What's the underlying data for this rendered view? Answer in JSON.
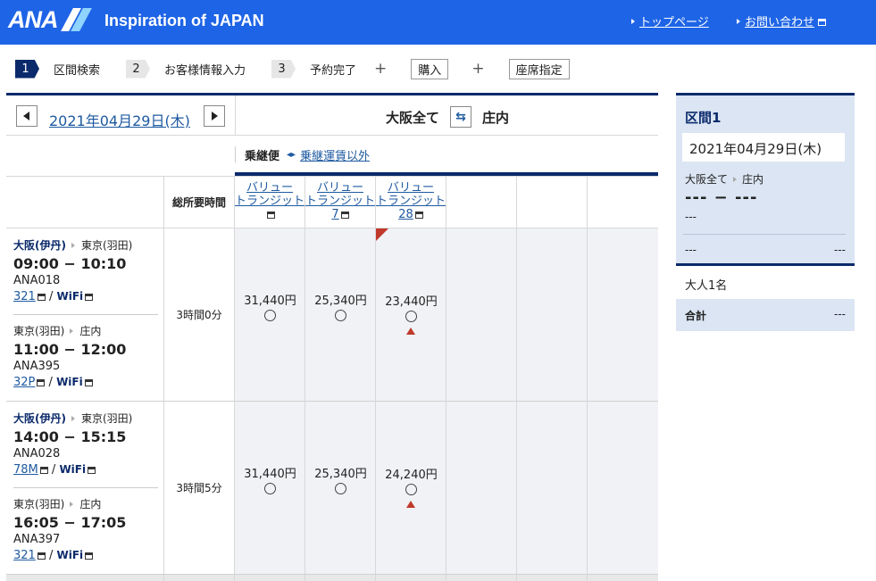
{
  "header": {
    "logo": "ANA",
    "tagline": "Inspiration of JAPAN",
    "links": [
      "トップページ",
      "お問い合わせ"
    ]
  },
  "steps": {
    "items": [
      {
        "num": "1",
        "label": "区間検索"
      },
      {
        "num": "2",
        "label": "お客様情報入力"
      },
      {
        "num": "3",
        "label": "予約完了"
      }
    ],
    "plus": "+",
    "options": [
      "購入",
      "座席指定"
    ]
  },
  "search": {
    "date": "2021年04月29日(木)",
    "origin": "大阪全て",
    "destination": "庄内",
    "swap_icon": "⇆"
  },
  "filter": {
    "label": "乗継便",
    "arrow": "◂▸",
    "link": "乗継運賃以外"
  },
  "table": {
    "duration_header": "総所要時間",
    "fares": [
      {
        "line1": "バリュー",
        "line2": "トランジット",
        "line3": ""
      },
      {
        "line1": "バリュー",
        "line2": "トランジット",
        "line3": "7"
      },
      {
        "line1": "バリュー",
        "line2": "トランジット",
        "line3": "28"
      }
    ],
    "rows": [
      {
        "duration": "3時間0分",
        "legs": [
          {
            "from": "大阪(伊丹)",
            "to": "東京(羽田)",
            "time": "09:00 − 10:10",
            "flight": "ANA018",
            "aircraft": "321",
            "wifi": "WiFi"
          },
          {
            "from": "東京(羽田)",
            "to": "庄内",
            "time": "11:00 − 12:00",
            "flight": "ANA395",
            "aircraft": "32P",
            "wifi": "WiFi"
          }
        ],
        "prices": [
          "31,440円",
          "25,340円",
          "23,440円"
        ]
      },
      {
        "duration": "3時間5分",
        "legs": [
          {
            "from": "大阪(伊丹)",
            "to": "東京(羽田)",
            "time": "14:00 − 15:15",
            "flight": "ANA028",
            "aircraft": "78M",
            "wifi": "WiFi"
          },
          {
            "from": "東京(羽田)",
            "to": "庄内",
            "time": "16:05 − 17:05",
            "flight": "ANA397",
            "aircraft": "321",
            "wifi": "WiFi"
          }
        ],
        "prices": [
          "31,440円",
          "25,340円",
          "24,240円"
        ]
      }
    ],
    "sep": "/"
  },
  "sidebar": {
    "title": "区間1",
    "date": "2021年04月29日(木)",
    "origin": "大阪全て",
    "destination": "庄内",
    "times": "--- − ---",
    "flight": "---",
    "left_val": "---",
    "right_val": "---",
    "passengers": "大人1名",
    "total_label": "合計",
    "total_value": "---"
  },
  "colors": {
    "brand_blue": "#1e64e6",
    "navy": "#0b2a6b",
    "link": "#1e5aa0",
    "alert_red": "#c0392b"
  }
}
